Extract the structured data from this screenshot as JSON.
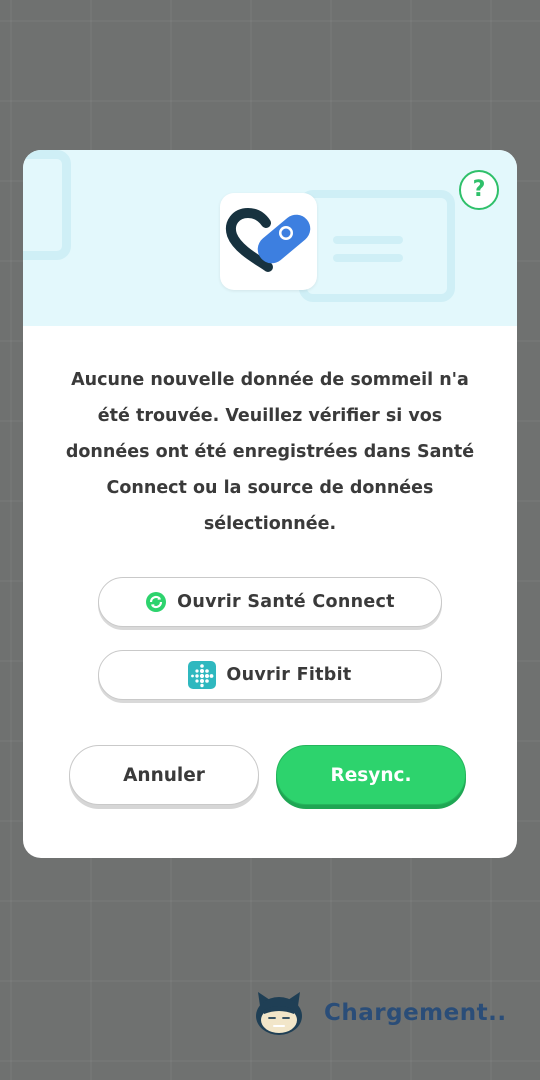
{
  "dialog": {
    "help_label": "?",
    "message": "Aucune nouvelle donnée de sommeil n'a été trouvée. Veuillez vérifier si vos données ont été enregistrées dans Santé Connect ou la source de données sélectionnée.",
    "open_health_connect": {
      "label": "Ouvrir Santé Connect",
      "icon": "health-connect-icon"
    },
    "open_fitbit": {
      "label": "Ouvrir Fitbit",
      "icon": "fitbit-icon"
    },
    "cancel_label": "Annuler",
    "resync_label": "Resync.",
    "header_icon": "health-connect-app-icon"
  },
  "loading": {
    "text": "Chargement..",
    "icon": "snorlax-icon"
  },
  "colors": {
    "accent_green": "#2dd36d",
    "header_bg": "#e3f8fc",
    "loading_text": "#2a4d78",
    "overlay_bg": "#6f7170"
  }
}
